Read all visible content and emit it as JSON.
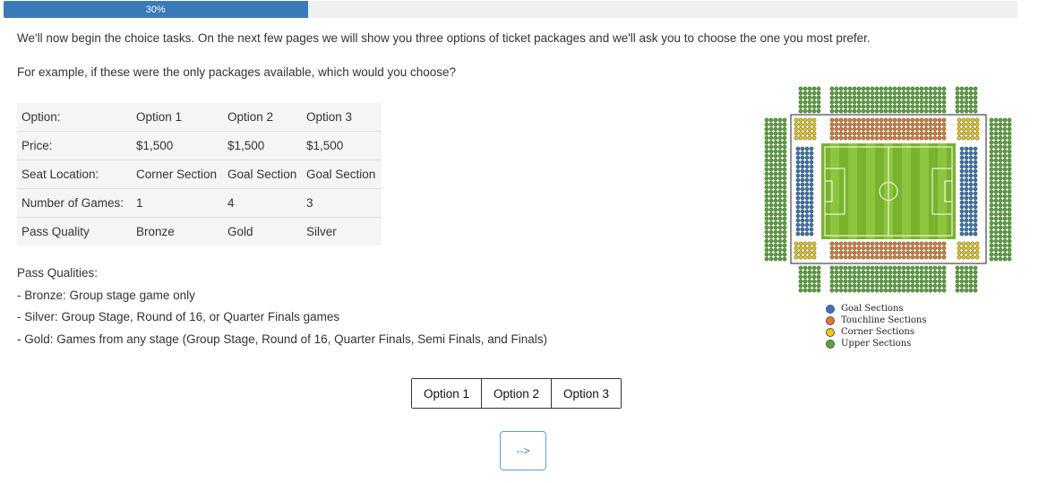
{
  "progress": {
    "label": "30%",
    "value": 0.3,
    "color": "#3a7ab8"
  },
  "intro": "We'll now begin the choice tasks. On the next few pages we will show you three options of ticket packages and we'll ask you to choose the one you most prefer.",
  "question": "For example, if these were the only packages available, which would you choose?",
  "table": {
    "rows": [
      [
        "Option:",
        "Option 1",
        "Option 2",
        "Option 3"
      ],
      [
        "Price:",
        "$1,500",
        "$1,500",
        "$1,500"
      ],
      [
        "Seat Location:",
        "Corner Section",
        "Goal Section",
        "Goal Section"
      ],
      [
        "Number of Games:",
        "1",
        "4",
        "3"
      ],
      [
        "Pass Quality",
        "Bronze",
        "Gold",
        "Silver"
      ]
    ]
  },
  "pass_qualities": {
    "title": "Pass Qualities:",
    "items": [
      "- Bronze: Group stage game only",
      "- Silver: Group Stage, Round of 16, or Quarter Finals games",
      "- Gold: Games from any stage (Group Stage, Round of 16, Quarter Finals, Semi Finals, and Finals)"
    ]
  },
  "choices": [
    "Option 1",
    "Option 2",
    "Option 3"
  ],
  "next_label": "-->",
  "legend": [
    {
      "label": "Goal Sections",
      "color": "#3b6fc4"
    },
    {
      "label": "Touchline Sections",
      "color": "#e8763a"
    },
    {
      "label": "Corner Sections",
      "color": "#f5c518"
    },
    {
      "label": "Upper Sections",
      "color": "#5aa53c"
    }
  ]
}
